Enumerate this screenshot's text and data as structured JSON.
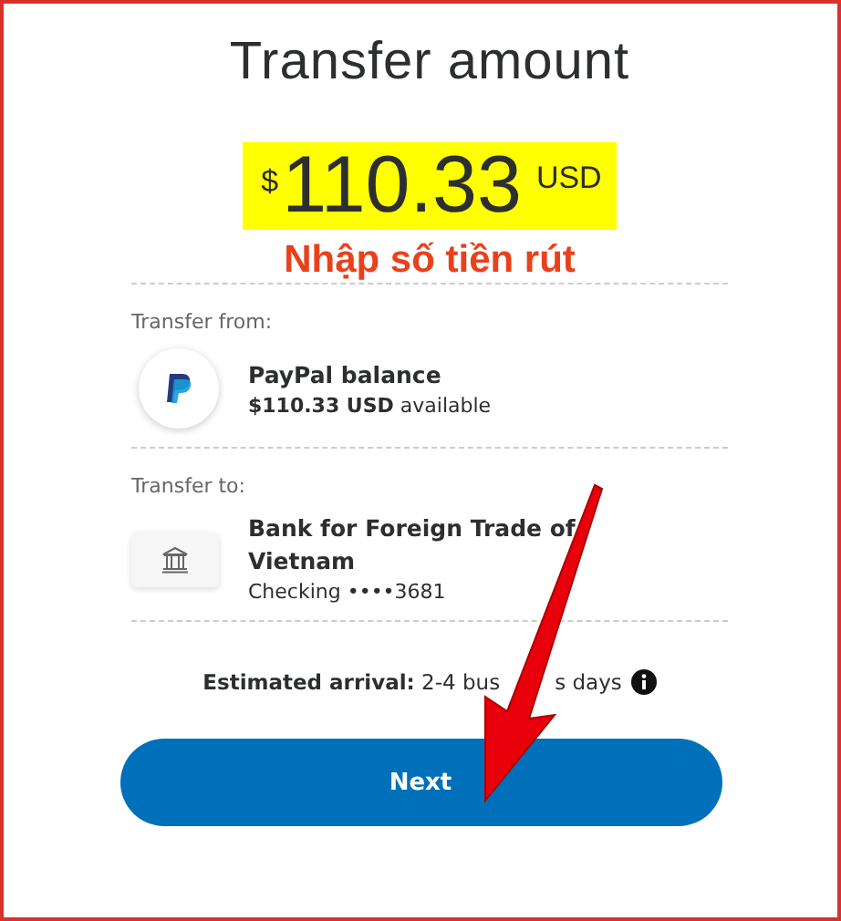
{
  "title": "Transfer amount",
  "amount": {
    "symbol": "$",
    "value": "110.33",
    "currency": "USD"
  },
  "annotation": "Nhập số tiền rút",
  "sections": [
    {
      "label": "Transfer from:",
      "kind": "paypal",
      "name": "PayPal balance",
      "detail": "**$110.33 USD** available"
    },
    {
      "label": "Transfer to:",
      "kind": "bank",
      "name": "Bank for Foreign Trade of Vietnam",
      "detail": "Checking ••••3681"
    }
  ],
  "arrival": {
    "before": "**Estimated arrival:** 2-4 bus",
    "after": "s days"
  },
  "button": "Next"
}
